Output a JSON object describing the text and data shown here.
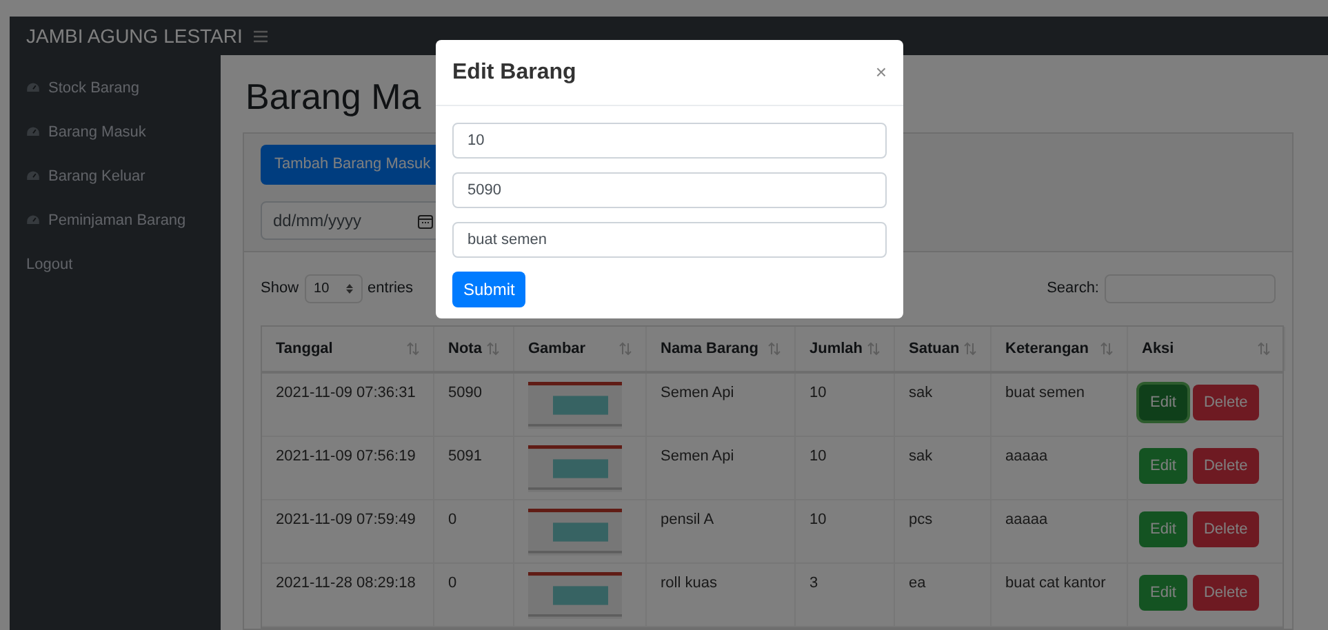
{
  "navbar": {
    "brand": "JAMBI AGUNG LESTARI"
  },
  "sidebar": {
    "items": [
      {
        "label": "Stock Barang",
        "kind": "icon"
      },
      {
        "label": "Barang Masuk",
        "kind": "icon"
      },
      {
        "label": "Barang Keluar",
        "kind": "icon"
      },
      {
        "label": "Peminjaman Barang",
        "kind": "icon"
      },
      {
        "label": "Logout",
        "kind": "plain"
      }
    ]
  },
  "page": {
    "title": "Barang Ma",
    "add_button": "Tambah Barang Masuk",
    "date_field": {
      "placeholder": "dd/mm/yyyy"
    },
    "length": {
      "before": "Show",
      "value": "10",
      "after": "entries"
    },
    "search": {
      "label": "Search:"
    }
  },
  "table": {
    "columns": [
      "Tanggal",
      "Nota",
      "Gambar",
      "Nama Barang",
      "Jumlah",
      "Satuan",
      "Keterangan",
      "Aksi"
    ],
    "rows": [
      {
        "cells": [
          "2021-11-09 07:36:31",
          "5090",
          "",
          "Semen Api",
          "10",
          "sak",
          "buat semen"
        ],
        "edit": "Edit",
        "delete": "Delete",
        "focused": true
      },
      {
        "cells": [
          "2021-11-09 07:56:19",
          "5091",
          "",
          "Semen Api",
          "10",
          "sak",
          "aaaaa"
        ],
        "edit": "Edit",
        "delete": "Delete",
        "focused": false
      },
      {
        "cells": [
          "2021-11-09 07:59:49",
          "0",
          "",
          "pensil A",
          "10",
          "pcs",
          "aaaaa"
        ],
        "edit": "Edit",
        "delete": "Delete",
        "focused": false
      },
      {
        "cells": [
          "2021-11-28 08:29:18",
          "0",
          "",
          "roll kuas",
          "3",
          "ea",
          "buat cat kantor"
        ],
        "edit": "Edit",
        "delete": "Delete",
        "focused": false
      }
    ]
  },
  "modal": {
    "title": "Edit Barang",
    "close": "×",
    "fields": [
      {
        "value": "10"
      },
      {
        "value": "5090"
      },
      {
        "value": "buat semen"
      }
    ],
    "submit": "Submit"
  }
}
